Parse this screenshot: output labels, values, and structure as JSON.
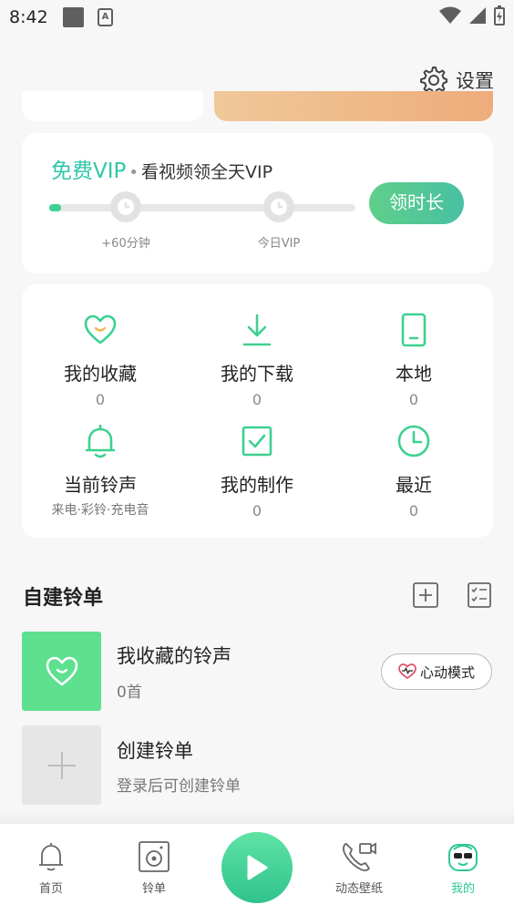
{
  "status_bar": {
    "time": "8:42"
  },
  "settings": {
    "label": "设置",
    "icon": "gear-icon"
  },
  "vip": {
    "title_free": "免费VIP",
    "separator": "•",
    "subtitle": "看视频领全天VIP",
    "progress": 0.04,
    "milestones": [
      "+60分钟",
      "今日VIP"
    ],
    "claim_button": "领时长"
  },
  "features": [
    {
      "label": "我的收藏",
      "count": "0",
      "icon": "heart-smile-icon"
    },
    {
      "label": "我的下载",
      "count": "0",
      "icon": "download-icon"
    },
    {
      "label": "本地",
      "count": "0",
      "icon": "phone-icon"
    },
    {
      "label": "当前铃声",
      "sub": "来电·彩铃·充电音",
      "icon": "bell-icon"
    },
    {
      "label": "我的制作",
      "count": "0",
      "icon": "checkbox-icon"
    },
    {
      "label": "最近",
      "count": "0",
      "icon": "clock-icon"
    }
  ],
  "playlists": {
    "section_title": "自建铃单",
    "items": [
      {
        "title": "我收藏的铃声",
        "sub": "0首",
        "badge": "心动模式"
      },
      {
        "title": "创建铃单",
        "sub": "登录后可创建铃单"
      }
    ]
  },
  "nav": {
    "items": [
      {
        "label": "首页",
        "icon": "bell-icon"
      },
      {
        "label": "铃单",
        "icon": "speaker-icon"
      },
      {
        "label": "动态壁纸",
        "icon": "phone-video-icon"
      },
      {
        "label": "我的",
        "icon": "avatar-icon",
        "active": true
      }
    ],
    "play_icon": "play-icon"
  },
  "colors": {
    "accent": "#3dd18f",
    "vip_text": "#31c6a8",
    "banner": "#eeac7b"
  }
}
